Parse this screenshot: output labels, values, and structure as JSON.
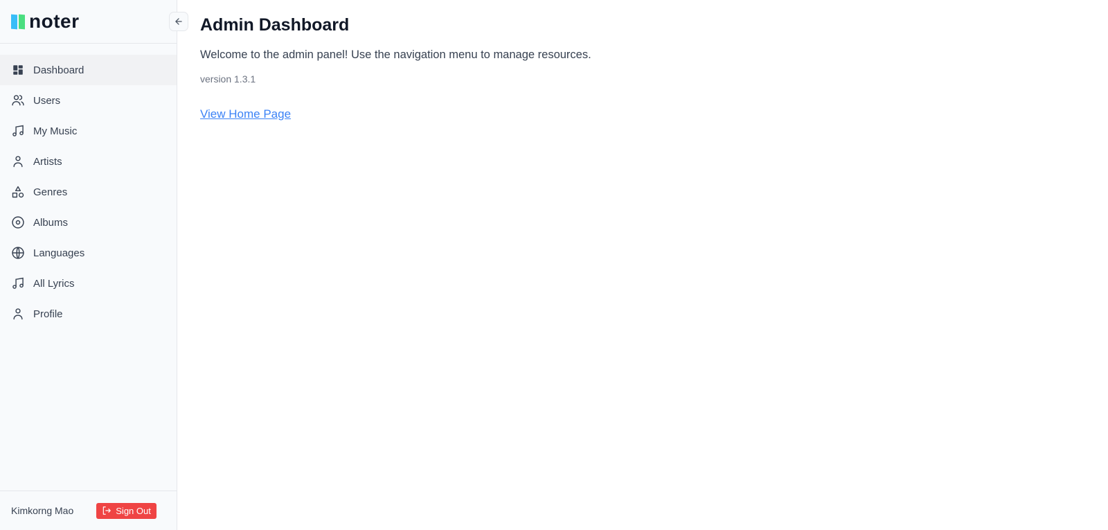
{
  "app": {
    "logo_text": "noter",
    "colors": {
      "logo_blue": "#38bdf8",
      "logo_green": "#4ade80",
      "link": "#3b82f6",
      "danger": "#ef4444"
    }
  },
  "sidebar": {
    "collapse_icon": "arrow-left-icon",
    "items": [
      {
        "label": "Dashboard",
        "icon": "dashboard-icon",
        "active": true
      },
      {
        "label": "Users",
        "icon": "users-icon"
      },
      {
        "label": "My Music",
        "icon": "music-note-icon"
      },
      {
        "label": "Artists",
        "icon": "user-icon"
      },
      {
        "label": "Genres",
        "icon": "shapes-icon"
      },
      {
        "label": "Albums",
        "icon": "disc-icon"
      },
      {
        "label": "Languages",
        "icon": "globe-icon"
      },
      {
        "label": "All Lyrics",
        "icon": "music-note-icon"
      },
      {
        "label": "Profile",
        "icon": "user-icon"
      }
    ],
    "footer": {
      "user_name": "Kimkorng Mao",
      "sign_out_label": "Sign Out",
      "sign_out_icon": "sign-out-icon"
    }
  },
  "main": {
    "title": "Admin Dashboard",
    "welcome": "Welcome to the admin panel! Use the navigation menu to manage resources.",
    "version": "version 1.3.1",
    "home_link": "View Home Page"
  }
}
